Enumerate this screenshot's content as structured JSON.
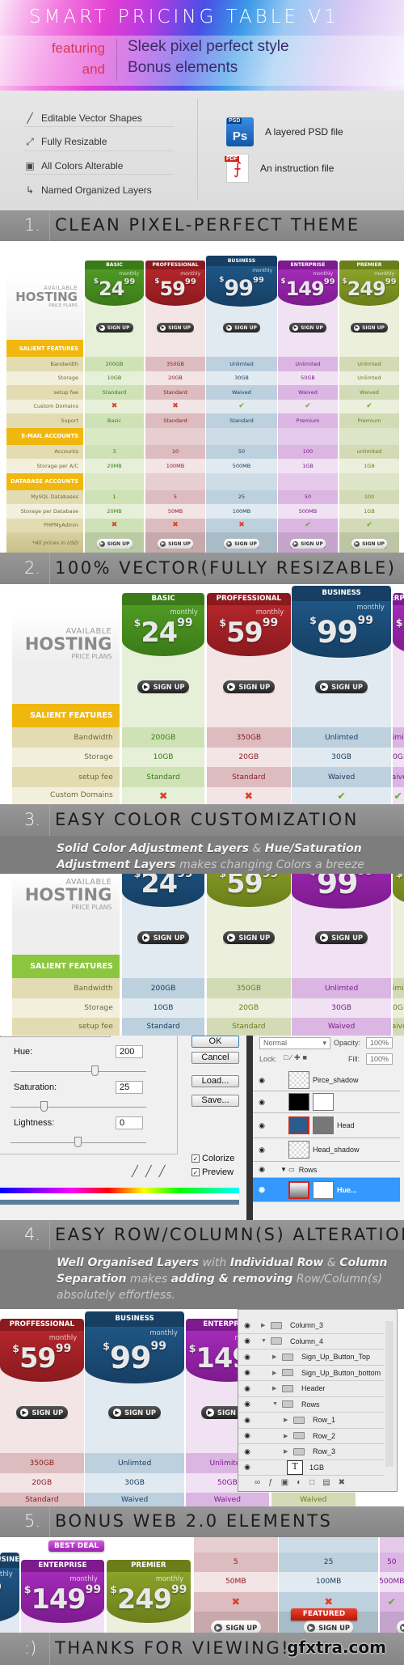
{
  "banner": {
    "title": "SMART PRICING TABLE V1",
    "featuring": "featuring",
    "and": "and",
    "line1": "Sleek pixel perfect style",
    "line2": "Bonus elements"
  },
  "features": {
    "items": [
      {
        "icon": "vector-pen-icon",
        "label": "Editable Vector Shapes"
      },
      {
        "icon": "resize-icon",
        "label": "Fully Resizable"
      },
      {
        "icon": "color-swatch-icon",
        "label": "All Colors Alterable"
      },
      {
        "icon": "layers-tree-icon",
        "label": "Named Organized Layers"
      }
    ],
    "files": [
      {
        "icon": "psd-file-icon",
        "badge": "PSD",
        "glyph": "Ps",
        "label": "A layered PSD file"
      },
      {
        "icon": "pdf-file-icon",
        "badge": "PDF",
        "label": "An instruction file"
      }
    ]
  },
  "sections": [
    {
      "num": "1.",
      "title": "CLEAN PIXEL-PERFECT THEME"
    },
    {
      "num": "2.",
      "title": "100% VECTOR(FULLY RESIZABLE)"
    },
    {
      "num": "3.",
      "title": "EASY COLOR CUSTOMIZATION",
      "caption": [
        {
          "t": "Solid Color Adjustment Layers",
          "s": "b"
        },
        {
          "t": " & ",
          "s": "l"
        },
        {
          "t": "Hue/Saturation Adjustment Layers",
          "s": "b"
        },
        {
          "t": " makes changing Colors a breeze",
          "s": "l"
        }
      ]
    },
    {
      "num": "4.",
      "title": "EASY ROW/COLUMN(S) ALTERATION",
      "caption": [
        {
          "t": "Well Organised Layers",
          "s": "b"
        },
        {
          "t": " with ",
          "s": "l"
        },
        {
          "t": "Individual Row",
          "s": "b"
        },
        {
          "t": " & ",
          "s": "l"
        },
        {
          "t": "Column Separation",
          "s": "b"
        },
        {
          "t": " makes ",
          "s": "l"
        },
        {
          "t": "adding & removing",
          "s": "b"
        },
        {
          "t": " Row/Column(s) absolutely effortless.",
          "s": "l"
        }
      ]
    },
    {
      "num": "5.",
      "title": "BONUS WEB 2.0 ELEMENTS"
    },
    {
      "num": ":)",
      "title": "THANKS FOR VIEWING!",
      "watermark": "gfxtra.com"
    }
  ],
  "pricing": {
    "available": "AVAILABLE",
    "hosting": "HOSTING",
    "price_plans": "PRICE PLANS",
    "monthly": "monthly",
    "currency": "$",
    "signup": "SIGN UP",
    "footnote": "*All prices in USD",
    "plans": [
      {
        "name": "BASIC",
        "dollars": "24",
        "cents": "99",
        "color": "#4f9a25"
      },
      {
        "name": "PROFFESSIONAL",
        "dollars": "59",
        "cents": "99",
        "color": "#b3262b"
      },
      {
        "name": "BUSINESS",
        "dollars": "99",
        "cents": "99",
        "color": "#1f5685"
      },
      {
        "name": "ENTERPRISE",
        "dollars": "149",
        "cents": "99",
        "color": "#a42bb8"
      },
      {
        "name": "PREMIER",
        "dollars": "249",
        "cents": "99",
        "color": "#8ca22a"
      }
    ],
    "rows": [
      {
        "type": "section",
        "label": "SALIENT FEATURES"
      },
      {
        "label": "Bandwidth",
        "values": [
          "200GB",
          "350GB",
          "Unlimted",
          "Unlimited",
          "Unlimted"
        ]
      },
      {
        "label": "Storage",
        "values": [
          "10GB",
          "20GB",
          "30GB",
          "50GB",
          "Unlimted"
        ]
      },
      {
        "label": "setup fee",
        "values": [
          "Standard",
          "Standard",
          "Waived",
          "Waived",
          "Waived"
        ]
      },
      {
        "label": "Custom Domains",
        "values": [
          "x",
          "x",
          "check",
          "check",
          "check"
        ]
      },
      {
        "label": "Suport",
        "values": [
          "Basic",
          "Standard",
          "Standard",
          "Premium",
          "Premium"
        ]
      },
      {
        "type": "section",
        "label": "E-MAIL ACCOUNTS"
      },
      {
        "label": "Accounts",
        "values": [
          "3",
          "10",
          "50",
          "100",
          "unlimited"
        ]
      },
      {
        "label": "Storage per A/C",
        "values": [
          "20MB",
          "100MB",
          "500MB",
          "1GB",
          "1GB"
        ]
      },
      {
        "type": "section",
        "label": "DATABASE ACCOUNTS"
      },
      {
        "label": "MySQL Databases",
        "values": [
          "1",
          "5",
          "25",
          "50",
          "100"
        ]
      },
      {
        "label": "Storage per Database",
        "values": [
          "20MB",
          "50MB",
          "100MB",
          "500MB",
          "1GB"
        ]
      },
      {
        "label": "PHPMyAdmin",
        "values": [
          "x",
          "x",
          "x",
          "check",
          "check"
        ]
      }
    ]
  },
  "bonus": {
    "best_deal": "BEST DEAL",
    "featured": "FEATURED"
  },
  "hue_dialog": {
    "hue_label": "Hue:",
    "hue": "200",
    "sat_label": "Saturation:",
    "sat": "25",
    "light_label": "Lightness:",
    "light": "0",
    "ok": "OK",
    "cancel": "Cancel",
    "load": "Load...",
    "save": "Save...",
    "colorize": "Colorize",
    "preview": "Preview",
    "colorize_checked": true,
    "preview_checked": true
  },
  "layers_panel_1": {
    "blend": "Normal",
    "opacity_label": "Opacity:",
    "opacity": "100%",
    "lock_label": "Lock:",
    "fill_label": "Fill:",
    "fill": "100%",
    "layers": [
      "Pirce_shadow",
      "",
      "Head",
      "Head_shadow",
      "Rows",
      "Hue..."
    ]
  },
  "layers_panel_2": {
    "layers": [
      "Column_3",
      "Column_4",
      "Sign_Up_Button_Top",
      "Sign_Up_Button_bottom",
      "Header",
      "Rows",
      "Row_1",
      "Row_2",
      "Row_3",
      "1GB"
    ]
  }
}
